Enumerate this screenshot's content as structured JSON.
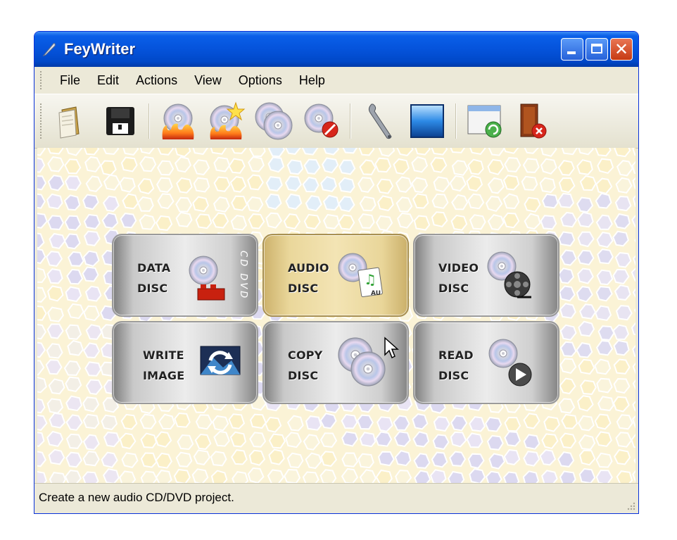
{
  "window": {
    "title": "FeyWriter"
  },
  "menu": [
    "File",
    "Edit",
    "Actions",
    "View",
    "Options",
    "Help"
  ],
  "toolbar": {
    "buttons": [
      "new-project-icon",
      "save-icon",
      "burn-disc-icon",
      "burn-disc-star-icon",
      "copy-disc-icon",
      "erase-disc-icon",
      "tools-icon",
      "view-icon",
      "refresh-window-icon",
      "exit-icon"
    ]
  },
  "tiles": {
    "data_disc": {
      "line1": "DATA",
      "line2": "DISC",
      "side_label": "CD DVD"
    },
    "audio_disc": {
      "line1": "AUDIO",
      "line2": "DISC",
      "badge": "AU"
    },
    "video_disc": {
      "line1": "VIDEO",
      "line2": "DISC"
    },
    "write_image": {
      "line1": "WRITE",
      "line2": "IMAGE"
    },
    "copy_disc": {
      "line1": "COPY",
      "line2": "DISC"
    },
    "read_disc": {
      "line1": "READ",
      "line2": "DISC"
    }
  },
  "status": {
    "text": "Create a new audio CD/DVD project."
  },
  "colors": {
    "title_bar": "#0553db",
    "active_tile": "#ead79b",
    "close_button": "#c63a13"
  }
}
